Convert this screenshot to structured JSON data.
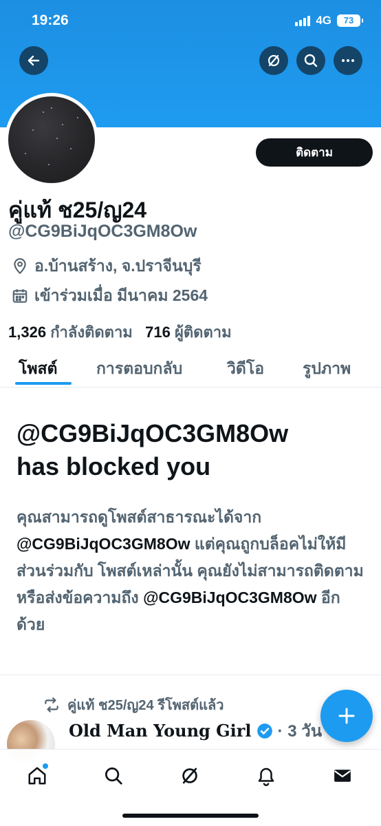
{
  "status_bar": {
    "time": "19:26",
    "network": "4G",
    "battery": "73"
  },
  "header": {
    "back_icon": "back-arrow-icon",
    "action_icons": [
      "grok-icon",
      "search-icon",
      "more-icon"
    ]
  },
  "profile": {
    "display_name": "คู่แท้ ช25/ญ24",
    "handle": "@CG9BiJqOC3GM8Ow",
    "follow_label": "ติดตาม",
    "location": "อ.บ้านสร้าง, จ.ปราจีนบุรี",
    "joined": "เข้าร่วมเมื่อ มีนาคม 2564",
    "following_count": "1,326",
    "following_label": "กำลังติดตาม",
    "followers_count": "716",
    "followers_label": "ผู้ติดตาม"
  },
  "tabs": [
    {
      "label": "โพสต์",
      "active": true
    },
    {
      "label": "การตอบกลับ",
      "active": false
    },
    {
      "label": "วิดีโอ",
      "active": false
    },
    {
      "label": "รูปภาพ",
      "active": false
    }
  ],
  "blocked": {
    "title_line1": "@CG9BiJqOC3GM8Ow",
    "title_line2": "has blocked you",
    "body_part1": "คุณสามารถดูโพสต์สาธารณะได้จาก",
    "body_handle1": "@CG9BiJqOC3GM8Ow",
    "body_part2": " แต่คุณถูกบล็อคไม่ให้มีส่วนร่วมกับ โพสต์เหล่านั้น คุณยังไม่สามารถติดตามหรือส่งข้อความถึง ",
    "body_handle2": "@CG9BiJqOC3GM8Ow",
    "body_part3": " อีกด้วย"
  },
  "post_preview": {
    "repost_label": "คู่แท้ ช25/ญ24 รีโพสต์แล้ว",
    "author": "Old Man Young Girl",
    "time": "· 3 วัน"
  },
  "fab_icon": "plus-icon",
  "bottom_nav": [
    "home-icon",
    "search-icon",
    "grok-icon",
    "notifications-icon",
    "messages-icon"
  ],
  "colors": {
    "accent": "#1d9bf0",
    "text": "#0f1419",
    "muted": "#536471",
    "banner": "#1e9bf0"
  }
}
